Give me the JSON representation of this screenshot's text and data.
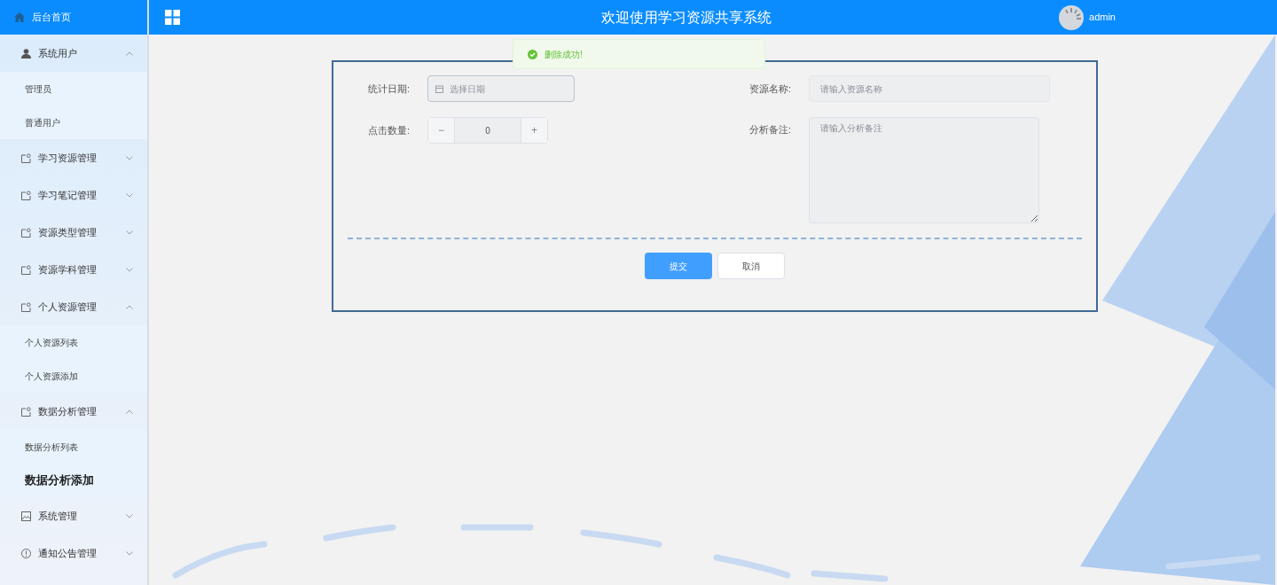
{
  "sidebar": {
    "home": "后台首页",
    "items": [
      {
        "label": "系统用户",
        "kind": "user",
        "expanded": true,
        "children": [
          {
            "label": "管理员",
            "selected": false
          },
          {
            "label": "普通用户",
            "selected": false
          }
        ]
      },
      {
        "label": "学习资源管理",
        "kind": "folder",
        "expanded": false
      },
      {
        "label": "学习笔记管理",
        "kind": "folder",
        "expanded": false
      },
      {
        "label": "资源类型管理",
        "kind": "folder",
        "expanded": false
      },
      {
        "label": "资源学科管理",
        "kind": "folder",
        "expanded": false
      },
      {
        "label": "个人资源管理",
        "kind": "folder",
        "expanded": true,
        "children": [
          {
            "label": "个人资源列表",
            "selected": false
          },
          {
            "label": "个人资源添加",
            "selected": false
          }
        ]
      },
      {
        "label": "数据分析管理",
        "kind": "folder",
        "expanded": true,
        "children": [
          {
            "label": "数据分析列表",
            "selected": false
          },
          {
            "label": "数据分析添加",
            "selected": true
          }
        ]
      },
      {
        "label": "系统管理",
        "kind": "image",
        "expanded": false
      },
      {
        "label": "通知公告管理",
        "kind": "info",
        "expanded": false
      }
    ]
  },
  "header": {
    "title": "欢迎使用学习资源共享系统",
    "user": "admin"
  },
  "toast": {
    "message": "删除成功!"
  },
  "form": {
    "date": {
      "label": "统计日期:",
      "placeholder": "选择日期"
    },
    "name": {
      "label": "资源名称:",
      "placeholder": "请输入资源名称"
    },
    "clicks": {
      "label": "点击数量:",
      "value": "0",
      "minus": "−",
      "plus": "+"
    },
    "notes": {
      "label": "分析备注:",
      "placeholder": "请输入分析备注"
    },
    "buttons": [
      {
        "label": "提交",
        "kind": "primary"
      },
      {
        "label": "取消",
        "kind": "default"
      }
    ]
  }
}
